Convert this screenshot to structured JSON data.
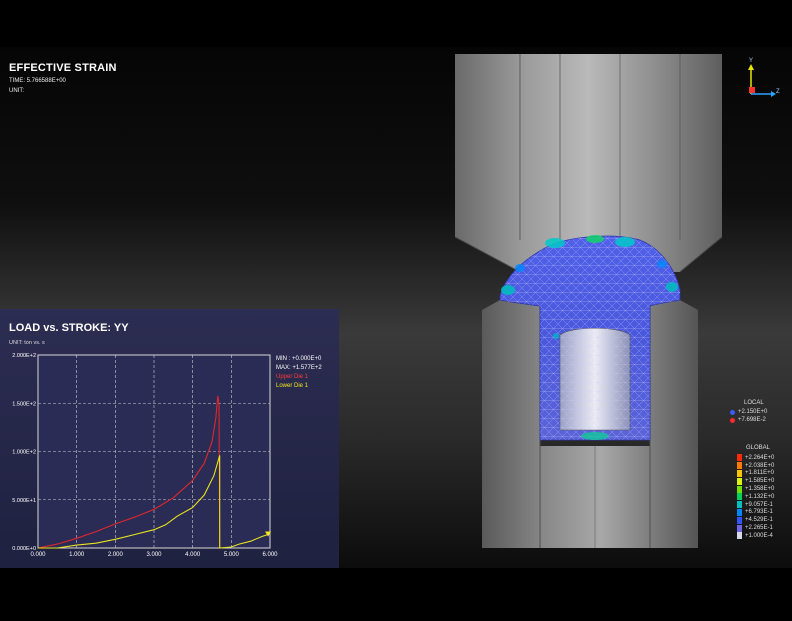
{
  "header": {
    "title": "EFFECTIVE STRAIN",
    "time_line": "TIME: 5.766588E+00",
    "unit_line": "UNIT:"
  },
  "triad": {
    "y_label": "Y",
    "z_label": "Z"
  },
  "local_legend": {
    "title": "LOCAL",
    "entries": [
      {
        "label": "+2.150E+0",
        "color": "#3b5bff"
      },
      {
        "label": "+7.698E-2",
        "color": "#ff2a2a"
      }
    ]
  },
  "global_legend": {
    "title": "GLOBAL",
    "entries": [
      {
        "label": "+2.264E+0",
        "color": "#ff2a00"
      },
      {
        "label": "+2.038E+0",
        "color": "#ff7a00"
      },
      {
        "label": "+1.811E+0",
        "color": "#ffc400"
      },
      {
        "label": "+1.585E+0",
        "color": "#d9f21a"
      },
      {
        "label": "+1.358E+0",
        "color": "#6fe000"
      },
      {
        "label": "+1.132E+0",
        "color": "#00d15a"
      },
      {
        "label": "+9.057E-1",
        "color": "#00c0c0"
      },
      {
        "label": "+6.793E-1",
        "color": "#0088ff"
      },
      {
        "label": "+4.529E-1",
        "color": "#3255ff"
      },
      {
        "label": "+2.265E-1",
        "color": "#6e66e6"
      },
      {
        "label": "+1.000E-4",
        "color": "#d8d8ec"
      }
    ]
  },
  "chart_panel": {
    "title": "LOAD vs. STROKE: YY",
    "unit": "UNIT:  ton vs. s",
    "info": {
      "min": "MIN : +0.000E+0",
      "max": "MAX: +1.577E+2",
      "upper_die": "Upper Die 1",
      "lower_die": "Lower Die 1"
    }
  },
  "chart_data": {
    "type": "line",
    "title": "LOAD vs. STROKE: YY",
    "xlabel": "",
    "ylabel": "",
    "xlim": [
      0,
      6
    ],
    "ylim": [
      0,
      200
    ],
    "x_ticks": [
      "0.000",
      "1.000",
      "2.000",
      "3.000",
      "4.000",
      "5.000",
      "6.000"
    ],
    "y_ticks": [
      "0.000E+0",
      "5.000E+1",
      "1.000E+2",
      "1.500E+2",
      "2.000E+2"
    ],
    "grid": true,
    "series": [
      {
        "name": "Upper Die 1",
        "color": "#e0272d",
        "points": [
          [
            0,
            0
          ],
          [
            0.5,
            4
          ],
          [
            1,
            10
          ],
          [
            1.5,
            17
          ],
          [
            2,
            25
          ],
          [
            2.5,
            32
          ],
          [
            3,
            40
          ],
          [
            3.5,
            52
          ],
          [
            4,
            70
          ],
          [
            4.3,
            88
          ],
          [
            4.5,
            110
          ],
          [
            4.6,
            135
          ],
          [
            4.65,
            157.7
          ],
          [
            4.68,
            150
          ],
          [
            4.7,
            0
          ]
        ]
      },
      {
        "name": "Lower Die 1",
        "color": "#e9e41f",
        "points": [
          [
            0,
            0
          ],
          [
            0.5,
            0
          ],
          [
            1,
            3
          ],
          [
            1.5,
            5
          ],
          [
            2,
            9
          ],
          [
            2.5,
            14
          ],
          [
            3,
            19
          ],
          [
            3.3,
            24
          ],
          [
            3.6,
            33
          ],
          [
            4,
            42
          ],
          [
            4.3,
            55
          ],
          [
            4.55,
            75
          ],
          [
            4.7,
            96
          ],
          [
            4.7,
            0
          ],
          [
            5,
            1
          ],
          [
            5.2,
            4
          ],
          [
            5.5,
            7
          ],
          [
            5.8,
            12
          ],
          [
            5.95,
            14
          ]
        ]
      }
    ]
  }
}
